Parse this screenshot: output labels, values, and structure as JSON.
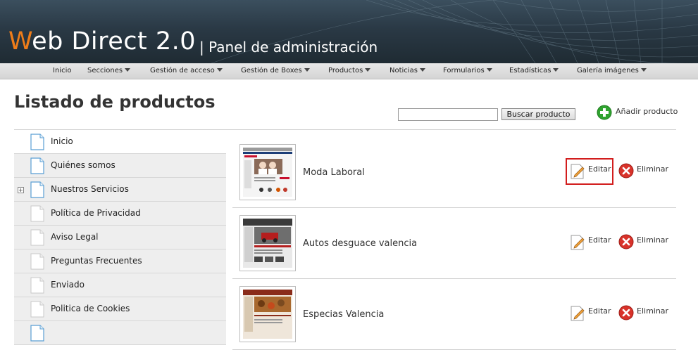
{
  "header": {
    "logo_w": "W",
    "logo_rest": "eb Direct 2.0",
    "subtitle": "| Panel de administración",
    "brand_color": "#ee7d1a"
  },
  "nav": {
    "items": [
      {
        "label": "Inicio",
        "dropdown": false
      },
      {
        "label": "Secciones",
        "dropdown": true
      },
      {
        "label": "Gestión de acceso",
        "dropdown": true
      },
      {
        "label": "Gestión de Boxes",
        "dropdown": true
      },
      {
        "label": "Productos",
        "dropdown": true
      },
      {
        "label": "Noticias",
        "dropdown": true
      },
      {
        "label": "Formularios",
        "dropdown": true
      },
      {
        "label": "Estadísticas",
        "dropdown": true
      },
      {
        "label": "Galería imágenes",
        "dropdown": true
      }
    ]
  },
  "main": {
    "title": "Listado de productos",
    "search": {
      "value": "",
      "button_label": "Buscar producto"
    },
    "add_label": "Añadir producto"
  },
  "sidebar": {
    "items": [
      {
        "label": "Inicio",
        "expandable": false
      },
      {
        "label": "Quiénes somos",
        "expandable": false
      },
      {
        "label": "Nuestros Servicios",
        "expandable": true
      },
      {
        "label": "Política de Privacidad",
        "expandable": false
      },
      {
        "label": "Aviso Legal",
        "expandable": false
      },
      {
        "label": "Preguntas Frecuentes",
        "expandable": false
      },
      {
        "label": "Enviado",
        "expandable": false
      },
      {
        "label": "Politica de Cookies",
        "expandable": false
      },
      {
        "label": "",
        "expandable": false
      }
    ]
  },
  "products": {
    "edit_label": "Editar",
    "delete_label": "Eliminar",
    "items": [
      {
        "name": "Moda Laboral"
      },
      {
        "name": "Autos desguace valencia"
      },
      {
        "name": "Especias Valencia"
      }
    ]
  },
  "colors": {
    "highlight": "#d21d1d",
    "add_green": "#2fa32f",
    "delete_red": "#d8322a"
  }
}
